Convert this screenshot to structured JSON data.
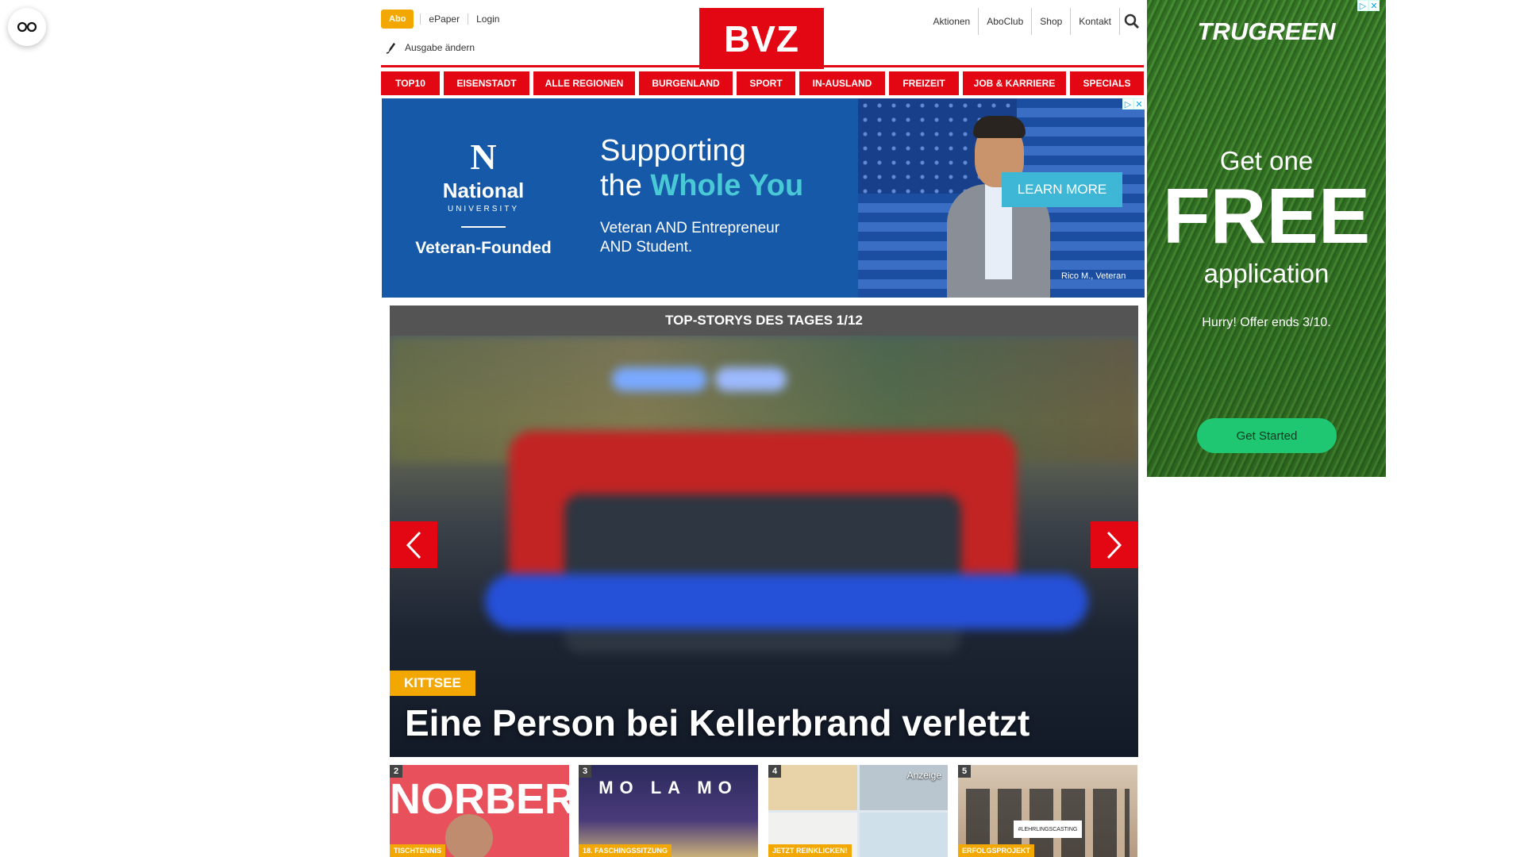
{
  "header": {
    "abo_label": "Abo",
    "top_links": [
      "ePaper",
      "Login"
    ],
    "ausgabe_label": "Ausgabe ändern",
    "logo_text": "BVZ",
    "right_links": [
      "Aktionen",
      "AboClub",
      "Shop",
      "Kontakt"
    ]
  },
  "nav": {
    "items": [
      "TOP10",
      "EISENSTADT",
      "ALLE REGIONEN",
      "BURGENLAND",
      "SPORT",
      "IN-AUSLAND",
      "FREIZEIT",
      "JOB & KARRIERE",
      "SPECIALS"
    ]
  },
  "banner_ad": {
    "brand_mark": "N",
    "brand_name": "National",
    "brand_sub": "UNIVERSITY",
    "tagline": "Veteran-Founded",
    "headline_1": "Supporting",
    "headline_2_prefix": "the ",
    "headline_2_accent": "Whole You",
    "body_1": "Veteran AND Entrepreneur",
    "body_2": "AND Student.",
    "cta": "LEARN MORE",
    "caption": "Rico M., Veteran"
  },
  "sky_ad": {
    "logo": "TRUGREEN",
    "line1": "Get one",
    "line2": "FREE",
    "line3": "application",
    "line4": "Hurry! Offer ends 3/10.",
    "cta": "Get Started"
  },
  "top_stories": {
    "header": "TOP-STORYS DES TAGES 1/12",
    "main": {
      "category": "KITTSEE",
      "title": "Eine Person bei Kellerbrand verletzt"
    },
    "thumbs": [
      {
        "num": "2",
        "category": "TISCHTENNIS",
        "overlay": "NORBERT"
      },
      {
        "num": "3",
        "category": "18. FASCHINGSSITZUNG",
        "overlay": "MO LA MO"
      },
      {
        "num": "4",
        "category": "JETZT REINKLICKEN!",
        "overlay": "Anzeige"
      },
      {
        "num": "5",
        "category": "ERFOLGSPROJEKT",
        "overlay": "#LEHRLINGSCASTING"
      }
    ]
  },
  "colors": {
    "brand_red": "#e30613",
    "accent_orange": "#f2a800"
  }
}
